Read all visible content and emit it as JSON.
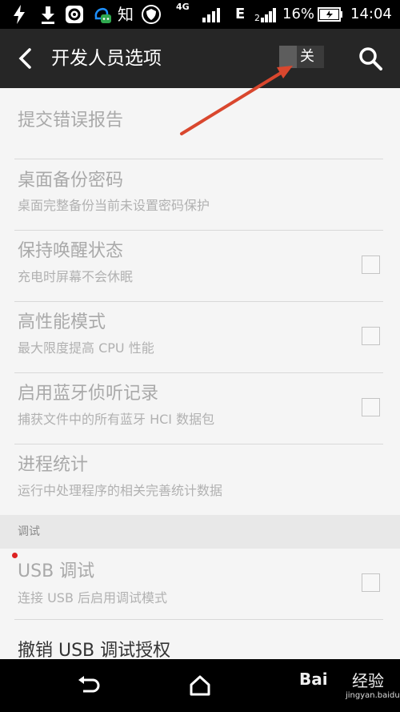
{
  "status_bar": {
    "signal_type": "4G",
    "network_label": "E",
    "battery_percent": "16%",
    "clock": "14:04",
    "icons": [
      "flash-icon",
      "download-icon",
      "settings-app-icon",
      "qq-icon",
      "zhihu-icon",
      "shield-icon",
      "signal-icon",
      "battery-icon"
    ],
    "zhihu_char": "知"
  },
  "action_bar": {
    "title": "开发人员选项",
    "toggle_label": "关",
    "toggle_state": "off"
  },
  "settings": {
    "items": [
      {
        "title": "提交错误报告"
      },
      {
        "title": "桌面备份密码",
        "subtitle": "桌面完整备份当前未设置密码保护"
      },
      {
        "title": "保持唤醒状态",
        "subtitle": "充电时屏幕不会休眠",
        "checked": false
      },
      {
        "title": "高性能模式",
        "subtitle": "最大限度提高 CPU 性能",
        "checked": false
      },
      {
        "title": "启用蓝牙侦听记录",
        "subtitle": "捕获文件中的所有蓝牙 HCI 数据包",
        "checked": false
      },
      {
        "title": "进程统计",
        "subtitle": "运行中处理程序的相关完善统计数据"
      }
    ],
    "section_debug": "调试",
    "debug_items": [
      {
        "title": "USB 调试",
        "subtitle": "连接 USB 后启用调试模式",
        "checked": false
      },
      {
        "title": "撤销 USB 调试授权"
      }
    ]
  },
  "colors": {
    "action_bar": "#262626",
    "content_bg": "#f5f5f5",
    "disabled_text": "#a9a9a9",
    "annotation_arrow": "#d9472e"
  },
  "watermark": {
    "logo": "Bai",
    "text": "经验",
    "url": "jingyan.baidu.com"
  }
}
